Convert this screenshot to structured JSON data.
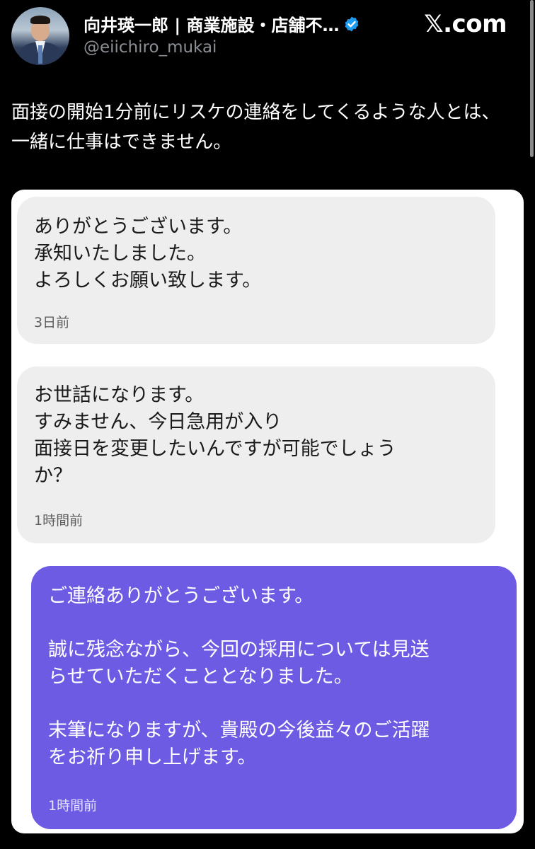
{
  "author": {
    "name": "向井瑛一郎 | 商業施設・店舗不…",
    "handle": "@eiichiro_mukai",
    "verified_icon": "verified-badge-icon",
    "verified_color": "#1d9bf0"
  },
  "brand": {
    "logo_text": "𝕏.com"
  },
  "tweet": {
    "text": "面接の開始1分前にリスケの連絡をしてくるような人とは、一緒に仕事はできません。"
  },
  "messages": [
    {
      "text": "ありがとうございます。\n承知いたしました。\nよろしくお願い致します。",
      "time": "3日前",
      "style": "gray"
    },
    {
      "text": "お世話になります。\nすみません、今日急用が入り\n面接日を変更したいんですが可能でしょう\nか？",
      "time": "1時間前",
      "style": "gray"
    },
    {
      "text": "ご連絡ありがとうございます。\n\n誠に残念ながら、今回の採用については見送\nらせていただくこととなりました。\n\n末筆になりますが、貴殿の今後益々のご活躍\nをお祈り申し上げます。",
      "time": "1時間前",
      "style": "purple"
    }
  ],
  "colors": {
    "background": "#000000",
    "card": "#ffffff",
    "bubble_gray": "#efeeee",
    "bubble_purple": "#6d5be3",
    "handle_gray": "#8b8f94"
  }
}
